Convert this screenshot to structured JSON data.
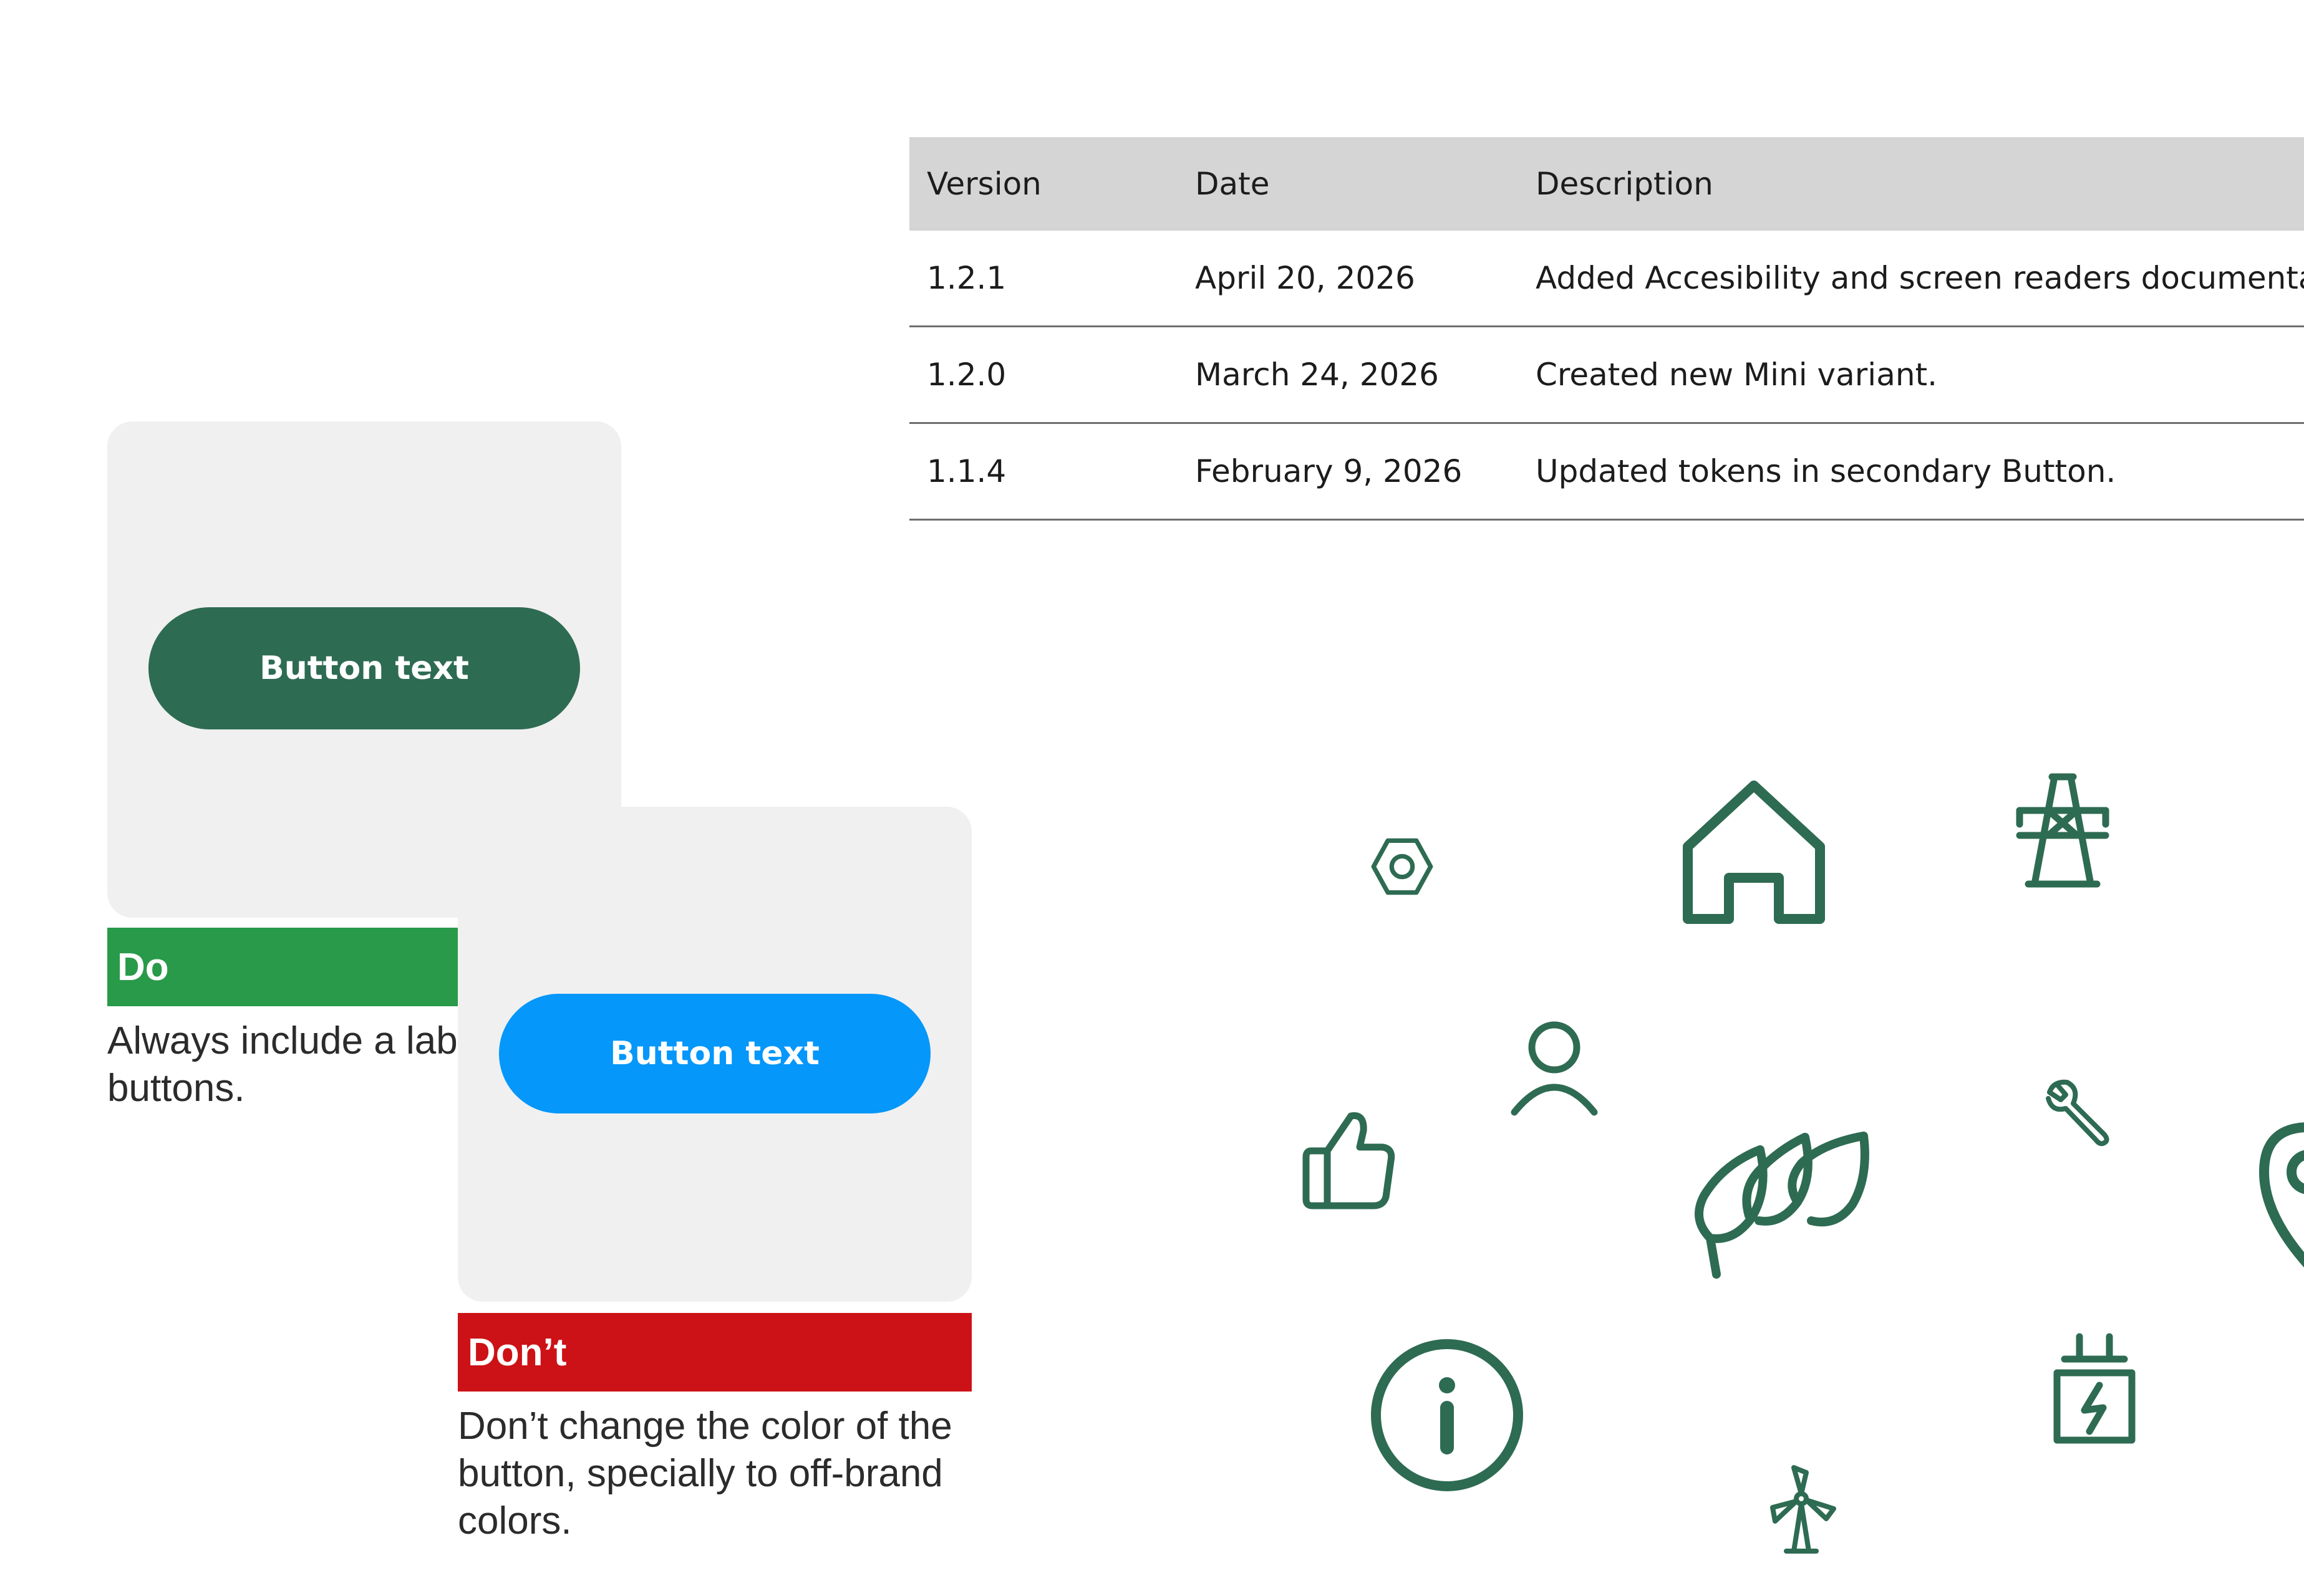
{
  "table": {
    "headers": [
      "Version",
      "Date",
      "Description"
    ],
    "rows": [
      [
        "1.2.1",
        "April 20, 2026",
        "Added Accesibility and screen readers documentatio"
      ],
      [
        "1.2.0",
        "March 24, 2026",
        "Created new Mini variant."
      ],
      [
        "1.1.4",
        "February 9, 2026",
        "Updated tokens in secondary Button."
      ]
    ]
  },
  "do_card": {
    "button_label": "Button text",
    "button_color": "#2e6b53",
    "banner_label": "Do",
    "banner_color": "#289a4a",
    "caption_line1": "Always include a lab",
    "caption_line2": "buttons."
  },
  "dont_card": {
    "button_label": "Button text",
    "button_color": "#0597fa",
    "banner_label": "Don’t",
    "banner_color": "#cc1216",
    "caption_line1": "Don’t change the color of the",
    "caption_line2": "button, specially to off-brand",
    "caption_line3": "colors."
  },
  "icons": {
    "color": "#2e6b53",
    "names": [
      "nut-icon",
      "home-icon",
      "power-tower-icon",
      "user-icon",
      "thumbs-up-icon",
      "wrench-icon",
      "leaves-icon",
      "location-pin-icon",
      "info-icon",
      "wind-turbine-icon",
      "plug-charging-icon"
    ]
  }
}
